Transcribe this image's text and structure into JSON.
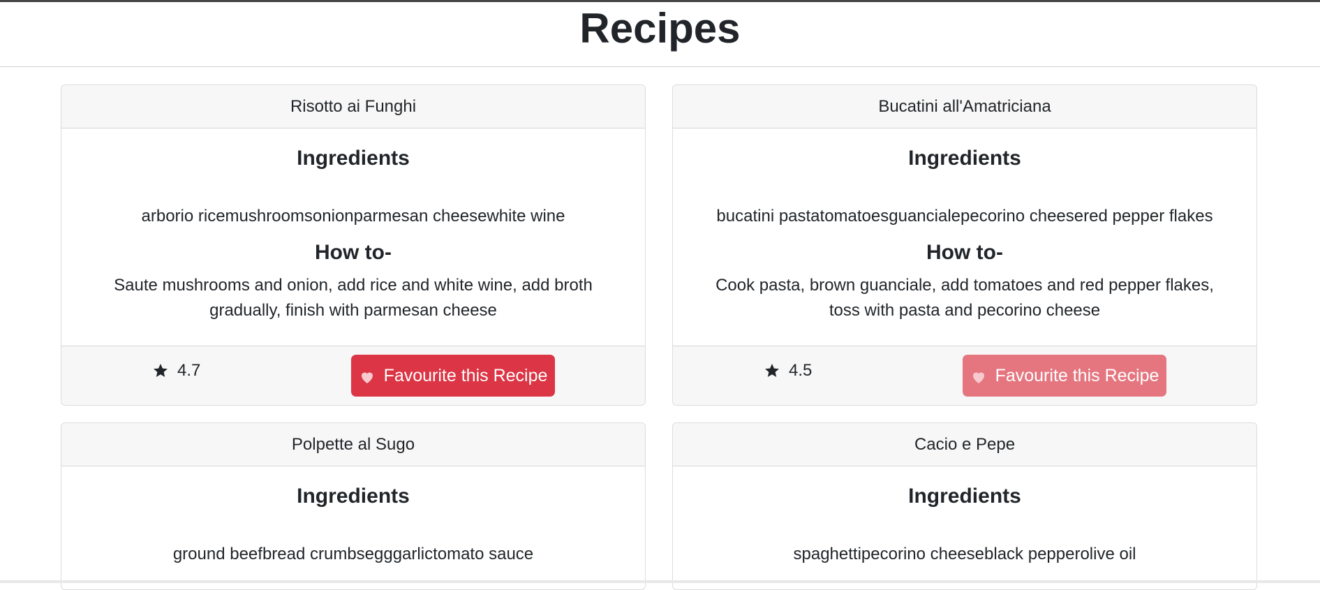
{
  "page": {
    "title": "Recipes"
  },
  "colors": {
    "button_active": "#dc3545",
    "button_faded": "#e57680",
    "heart": "#f8c9cf"
  },
  "recipes": [
    {
      "name": "Risotto ai Funghi",
      "ingredients_heading": "Ingredients",
      "ingredients": "arborio ricemushroomsonionparmesan cheesewhite wine",
      "howto_heading": "How to-",
      "steps": "Saute mushrooms and onion, add rice and white wine, add broth gradually, finish with parmesan cheese",
      "rating": "4.7",
      "favourite_label": "Favourite this Recipe",
      "star_icon": "star-icon",
      "heart_icon": "heart-icon"
    },
    {
      "name": "Bucatini all'Amatriciana",
      "ingredients_heading": "Ingredients",
      "ingredients": "bucatini pastatomatoesguancialepecorino cheesered pepper flakes",
      "howto_heading": "How to-",
      "steps": "Cook pasta, brown guanciale, add tomatoes and red pepper flakes, toss with pasta and pecorino cheese",
      "rating": "4.5",
      "favourite_label": "Favourite this Recipe",
      "star_icon": "star-icon",
      "heart_icon": "heart-icon"
    },
    {
      "name": "Polpette al Sugo",
      "ingredients_heading": "Ingredients",
      "ingredients": "ground beefbread crumbsegggarlictomato sauce"
    },
    {
      "name": "Cacio e Pepe",
      "ingredients_heading": "Ingredients",
      "ingredients": "spaghettipecorino cheeseblack pepperolive oil"
    }
  ]
}
